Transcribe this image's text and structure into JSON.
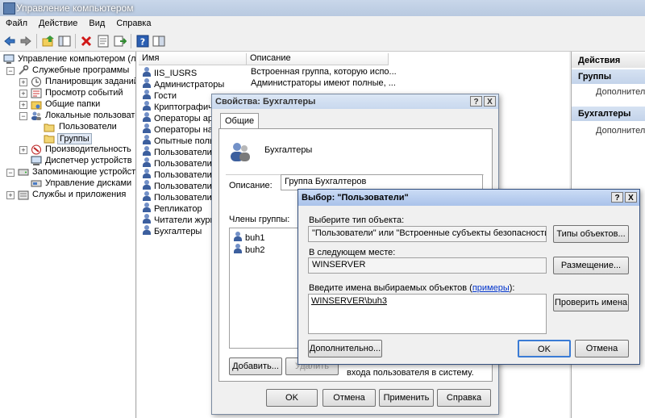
{
  "window": {
    "title": "Управление компьютером"
  },
  "menu": [
    "Файл",
    "Действие",
    "Вид",
    "Справка"
  ],
  "toolbar_icons": [
    "back-icon",
    "forward-icon",
    "up-icon",
    "show-tree-icon",
    "delete-icon",
    "properties-icon",
    "export-icon",
    "help-icon",
    "view-icon"
  ],
  "tree": {
    "root": "Управление компьютером (лока",
    "items": [
      {
        "label": "Служебные программы",
        "expander": "−"
      },
      {
        "label": "Планировщик заданий",
        "expander": "+"
      },
      {
        "label": "Просмотр событий",
        "expander": "+"
      },
      {
        "label": "Общие папки",
        "expander": "+"
      },
      {
        "label": "Локальные пользовател",
        "expander": "−"
      },
      {
        "label": "Пользователи",
        "expander": ""
      },
      {
        "label": "Группы",
        "expander": ""
      },
      {
        "label": "Производительность",
        "expander": "+"
      },
      {
        "label": "Диспетчер устройств",
        "expander": ""
      },
      {
        "label": "Запоминающие устройства",
        "expander": "−"
      },
      {
        "label": "Управление дисками",
        "expander": ""
      },
      {
        "label": "Службы и приложения",
        "expander": "+"
      }
    ]
  },
  "list": {
    "col_name": "Имя",
    "col_desc": "Описание",
    "rows": [
      {
        "name": "IIS_IUSRS",
        "desc": "Встроенная группа, которую испо..."
      },
      {
        "name": "Администраторы",
        "desc": "Администраторы имеют полные, ..."
      },
      {
        "name": "Гости",
        "desc": ""
      },
      {
        "name": "Криптографиче",
        "desc": ""
      },
      {
        "name": "Операторы арх",
        "desc": ""
      },
      {
        "name": "Операторы нас",
        "desc": ""
      },
      {
        "name": "Опытные польз",
        "desc": ""
      },
      {
        "name": "Пользователи",
        "desc": ""
      },
      {
        "name": "Пользователи Д",
        "desc": ""
      },
      {
        "name": "Пользователи ж",
        "desc": ""
      },
      {
        "name": "Пользователи с",
        "desc": ""
      },
      {
        "name": "Пользователи у",
        "desc": ""
      },
      {
        "name": "Репликатор",
        "desc": ""
      },
      {
        "name": "Читатели журн",
        "desc": ""
      },
      {
        "name": "Бухгалтеры",
        "desc": ""
      }
    ]
  },
  "actions": {
    "title": "Действия",
    "sections": [
      {
        "header": "Группы",
        "item": "Дополнительн"
      },
      {
        "header": "Бухгалтеры",
        "item": "Дополнительн"
      }
    ]
  },
  "props": {
    "title": "Свойства: Бухгалтеры",
    "help": "?",
    "close": "X",
    "tab": "Общие",
    "group_name": "Бухгалтеры",
    "desc_label": "Описание:",
    "desc_value": "Группа Бухгалтеров",
    "members_label": "Члены группы:",
    "members": [
      "buh1",
      "buh2"
    ],
    "add_button": "Добавить...",
    "remove_button": "Удалить",
    "note": "входа пользователя в систему.",
    "ok": "OK",
    "cancel": "Отмена",
    "apply": "Применить",
    "help_button": "Справка"
  },
  "select": {
    "title": "Выбор: \"Пользователи\"",
    "help": "?",
    "close": "X",
    "type_label": "Выберите тип объекта:",
    "type_value": "\"Пользователи\" или \"Встроенные субъекты безопасности\"",
    "types_button": "Типы объектов...",
    "location_label": "В следующем месте:",
    "location_value": "WINSERVER",
    "location_button": "Размещение...",
    "names_label": "Введите имена выбираемых объектов (",
    "names_link": "примеры",
    "names_label_end": "):",
    "names_value": "WINSERVER\\buh3",
    "check_button": "Проверить имена",
    "advanced_button": "Дополнительно...",
    "ok": "OK",
    "cancel": "Отмена"
  }
}
